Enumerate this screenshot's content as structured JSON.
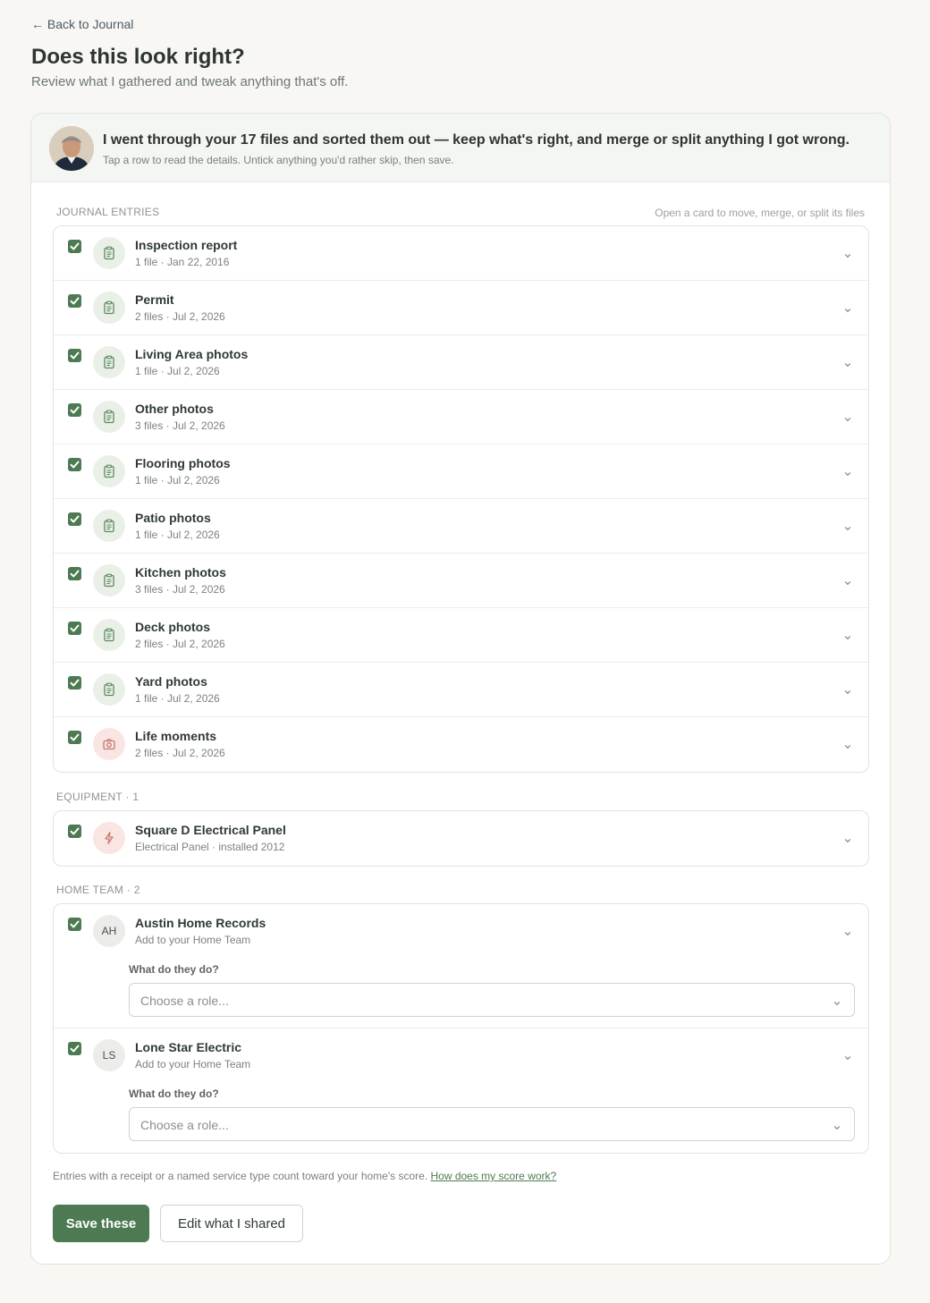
{
  "nav": {
    "back_label": "← Back to Journal"
  },
  "header": {
    "title": "Does this look right?",
    "subtitle": "Review what I gathered and tweak anything that's off."
  },
  "assistant": {
    "message": "I went through your 17 files and sorted them out — keep what's right, and merge or split anything I got wrong.",
    "hint": "Tap a row to read the details. Untick anything you'd rather skip, then save."
  },
  "journal": {
    "label": "JOURNAL ENTRIES",
    "aside": "Open a card to move, merge, or split its files",
    "entries": [
      {
        "title": "Inspection report",
        "meta": "1 file · Jan 22, 2016",
        "icon": "clipboard-icon",
        "checked": true
      },
      {
        "title": "Permit",
        "meta": "2 files · Jul 2, 2026",
        "icon": "clipboard-icon",
        "checked": true
      },
      {
        "title": "Living Area photos",
        "meta": "1 file · Jul 2, 2026",
        "icon": "clipboard-icon",
        "checked": true
      },
      {
        "title": "Other photos",
        "meta": "3 files · Jul 2, 2026",
        "icon": "clipboard-icon",
        "checked": true
      },
      {
        "title": "Flooring photos",
        "meta": "1 file · Jul 2, 2026",
        "icon": "clipboard-icon",
        "checked": true
      },
      {
        "title": "Patio photos",
        "meta": "1 file · Jul 2, 2026",
        "icon": "clipboard-icon",
        "checked": true
      },
      {
        "title": "Kitchen photos",
        "meta": "3 files · Jul 2, 2026",
        "icon": "clipboard-icon",
        "checked": true
      },
      {
        "title": "Deck photos",
        "meta": "2 files · Jul 2, 2026",
        "icon": "clipboard-icon",
        "checked": true
      },
      {
        "title": "Yard photos",
        "meta": "1 file · Jul 2, 2026",
        "icon": "clipboard-icon",
        "checked": true
      },
      {
        "title": "Life moments",
        "meta": "2 files · Jul 2, 2026",
        "icon": "camera-icon",
        "checked": true
      }
    ]
  },
  "equipment": {
    "label": "EQUIPMENT · 1",
    "items": [
      {
        "title": "Square D Electrical Panel",
        "meta": "Electrical Panel · installed 2012",
        "icon": "lightning-icon",
        "checked": true
      }
    ]
  },
  "team": {
    "label": "HOME TEAM · 2",
    "members": [
      {
        "initials": "AH",
        "name": "Austin Home Records",
        "meta": "Add to your Home Team",
        "role_label": "What do they do?",
        "role_placeholder": "Choose a role...",
        "checked": true
      },
      {
        "initials": "LS",
        "name": "Lone Star Electric",
        "meta": "Add to your Home Team",
        "role_label": "What do they do?",
        "role_placeholder": "Choose a role...",
        "checked": true
      }
    ]
  },
  "footer": {
    "note": "Entries with a receipt or a named service type count toward your home's score. ",
    "link": "How does my score work?"
  },
  "actions": {
    "save": "Save these",
    "edit": "Edit what I shared"
  },
  "colors": {
    "accent": "#4d7a52",
    "journal_icon_bg": "#eaf0e8",
    "pink_icon_bg": "#f9e6e3"
  }
}
